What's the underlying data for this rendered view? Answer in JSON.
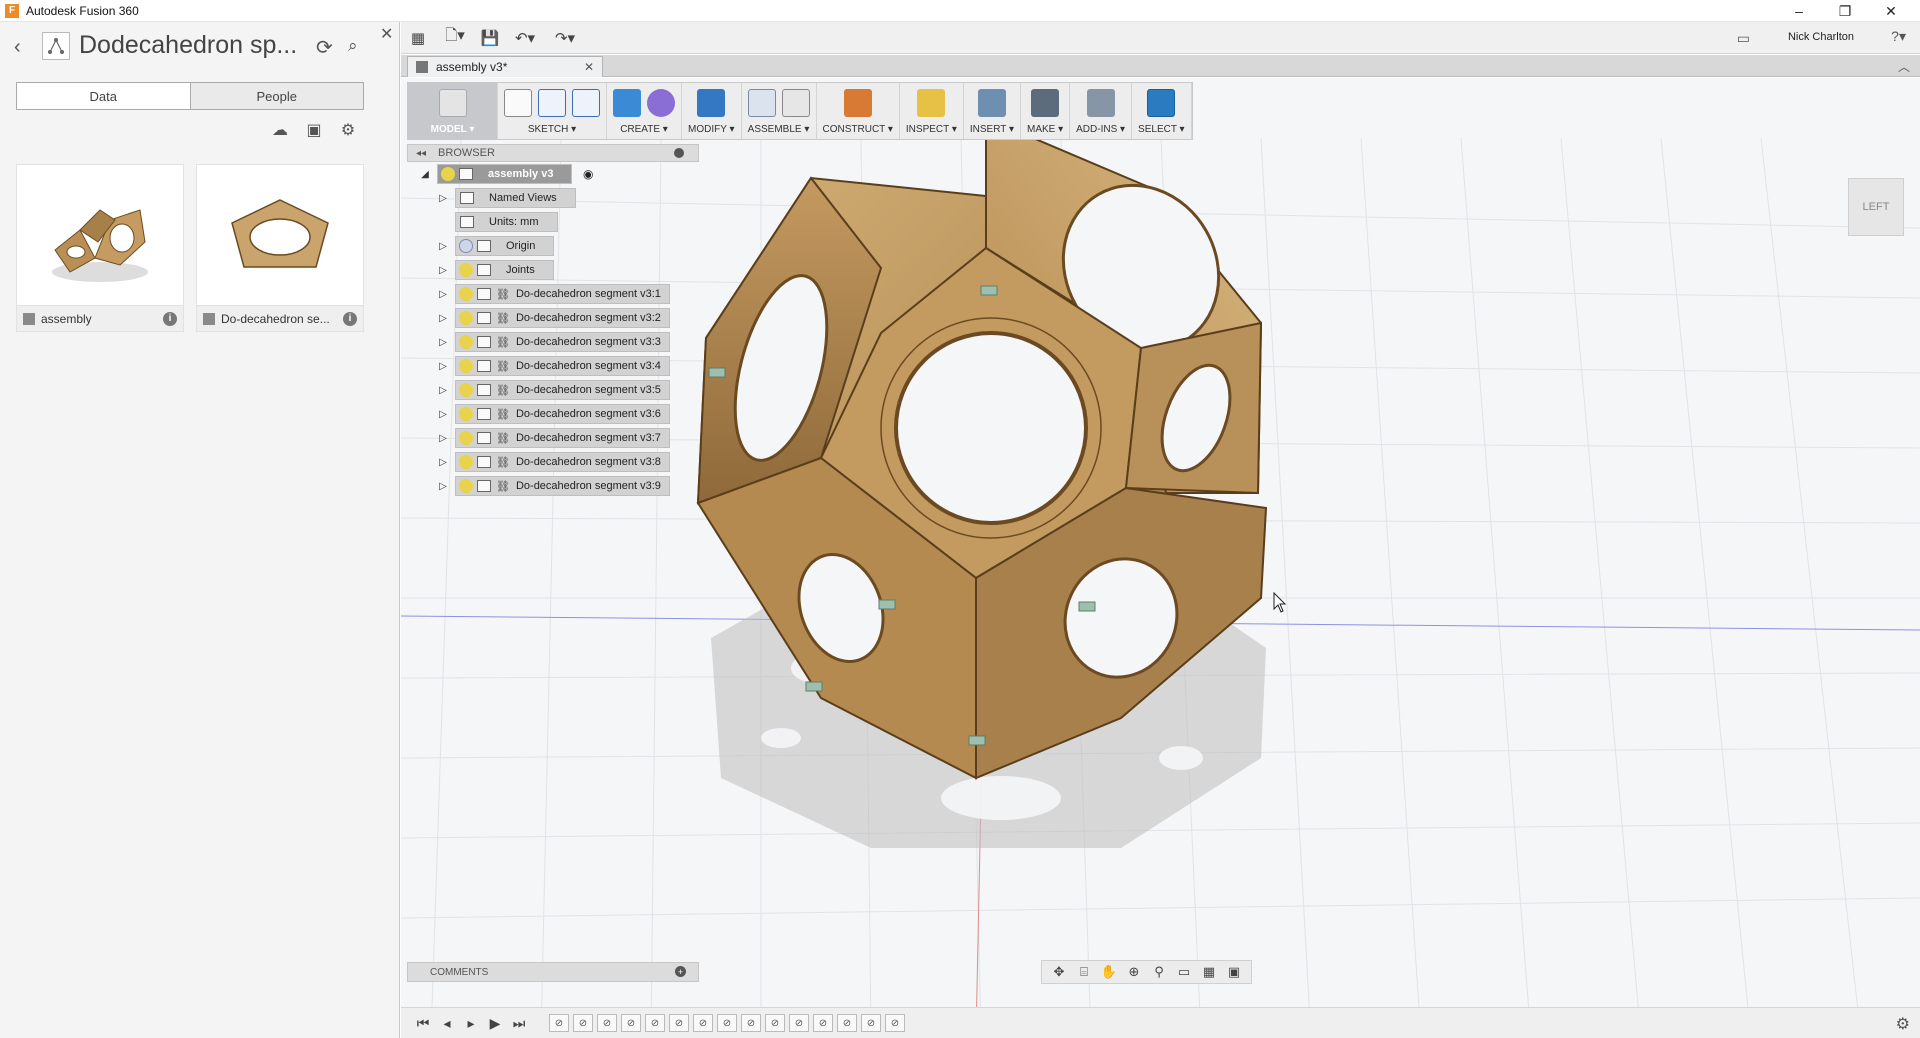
{
  "window": {
    "title": "Autodesk Fusion 360",
    "controls": [
      "–",
      "❐",
      "✕"
    ]
  },
  "data_panel": {
    "project_title": "Dodecahedron sp...",
    "tabs": [
      "Data",
      "People"
    ],
    "active_tab": "Data",
    "files": [
      {
        "name": "assembly",
        "info": "i"
      },
      {
        "name": "Do-decahedron se...",
        "info": "i"
      }
    ]
  },
  "toolbar": {
    "user_name": "Nick Charlton",
    "help": "?▾"
  },
  "document": {
    "tab_label": "assembly v3*"
  },
  "ribbon": {
    "groups": [
      "MODEL ▾",
      "SKETCH ▾",
      "CREATE ▾",
      "MODIFY ▾",
      "ASSEMBLE ▾",
      "CONSTRUCT ▾",
      "INSPECT ▾",
      "INSERT ▾",
      "MAKE ▾",
      "ADD-INS ▾",
      "SELECT ▾"
    ]
  },
  "browser": {
    "title": "BROWSER",
    "root": "assembly v3",
    "nodes": [
      {
        "label": "Named Views"
      },
      {
        "label": "Units: mm"
      },
      {
        "label": "Origin"
      },
      {
        "label": "Joints"
      },
      {
        "label": "Do-decahedron segment v3:1"
      },
      {
        "label": "Do-decahedron segment v3:2"
      },
      {
        "label": "Do-decahedron segment v3:3"
      },
      {
        "label": "Do-decahedron segment v3:4"
      },
      {
        "label": "Do-decahedron segment v3:5"
      },
      {
        "label": "Do-decahedron segment v3:6"
      },
      {
        "label": "Do-decahedron segment v3:7"
      },
      {
        "label": "Do-decahedron segment v3:8"
      },
      {
        "label": "Do-decahedron segment v3:9"
      }
    ]
  },
  "comments": {
    "label": "COMMENTS"
  },
  "viewcube": {
    "label": "LEFT"
  },
  "colors": {
    "wood_light": "#c9a46c",
    "wood_dark": "#8e6a3e",
    "accent_select": "#2a7bbf"
  }
}
